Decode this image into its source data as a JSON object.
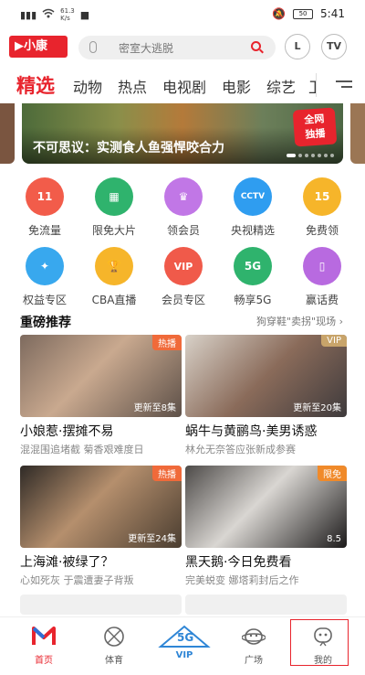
{
  "status": {
    "speed": "61.3\nK/s",
    "time": "5:41",
    "battery": "50"
  },
  "header": {
    "logo_text": "小康",
    "search_placeholder": "密室大逃脱",
    "history_label": "L",
    "tv_label": "TV"
  },
  "tabs": [
    "精选",
    "动物",
    "热点",
    "电视剧",
    "电影",
    "综艺",
    "卫"
  ],
  "banner": {
    "title": "不可思议：实测食人鱼强悍咬合力",
    "badge_line1": "全网",
    "badge_line2": "独播"
  },
  "grid": [
    {
      "label": "免流量",
      "color": "#f25c4a",
      "glyph": "11"
    },
    {
      "label": "限免大片",
      "color": "#2fb36d",
      "glyph": "▦"
    },
    {
      "label": "领会员",
      "color": "#c177e6",
      "glyph": "♛"
    },
    {
      "label": "央视精选",
      "color": "#2f9df0",
      "glyph": "CCTV"
    },
    {
      "label": "免费领",
      "color": "#f6b52a",
      "glyph": "15"
    },
    {
      "label": "权益专区",
      "color": "#38a8ee",
      "glyph": "✦"
    },
    {
      "label": "CBA直播",
      "color": "#f6b52a",
      "glyph": "🏆"
    },
    {
      "label": "会员专区",
      "color": "#f05a4a",
      "glyph": "VIP"
    },
    {
      "label": "畅享5G",
      "color": "#2fb36d",
      "glyph": "5G"
    },
    {
      "label": "赢话费",
      "color": "#b86ae0",
      "glyph": "▯"
    }
  ],
  "section": {
    "title": "重磅推荐",
    "more": "狗穿鞋\"卖拐\"现场"
  },
  "cards": [
    {
      "title": "小娘惹·摆摊不易",
      "sub": "混混围追堵截 菊香艰难度日",
      "tag": "热播",
      "tag_color": "#f06a3a",
      "ep": "更新至8集",
      "bg": "linear-gradient(135deg,#7d6a5e,#c9a98f 45%,#5d5048)"
    },
    {
      "title": "蜗牛与黄鹂鸟·美男诱惑",
      "sub": "林允无奈答应张新成参赛",
      "tag": "VIP",
      "tag_color": "#c8a46a",
      "ep": "更新至20集",
      "bg": "linear-gradient(135deg,#d8d1c8,#8a6b5a 50%,#3e3a3c)"
    },
    {
      "title": "上海滩·被绿了？",
      "sub": "心如死灰 于震遭妻子背叛",
      "tag": "热播",
      "tag_color": "#f06a3a",
      "ep": "更新至24集",
      "bg": "linear-gradient(135deg,#2f2a26,#b58f6d 45%,#4a3d30)"
    },
    {
      "title": "黑天鹅·今日免费看",
      "sub": "完美蜕变 娜塔莉封后之作",
      "tag": "限免",
      "tag_color": "#f08a2a",
      "ep": "8.5",
      "bg": "linear-gradient(135deg,#4d4a48,#d9d6d2 45%,#1c1a1a)"
    }
  ],
  "nav": [
    {
      "label": "首页",
      "icon": "home-icon"
    },
    {
      "label": "体育",
      "icon": "ball-icon"
    },
    {
      "label": "VIP",
      "icon": "vip-5g-icon"
    },
    {
      "label": "广场",
      "icon": "planet-icon"
    },
    {
      "label": "我的",
      "icon": "profile-icon"
    }
  ],
  "colors": {
    "accent": "#e8242d"
  }
}
